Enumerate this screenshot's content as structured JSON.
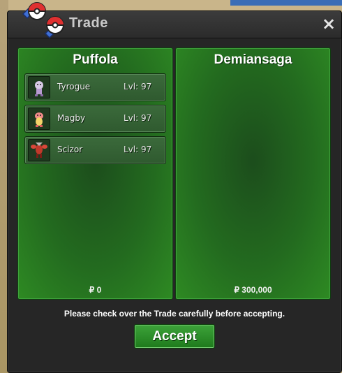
{
  "window": {
    "title": "Trade",
    "close_label": "×"
  },
  "left_panel": {
    "player": "Puffola",
    "pokemon": [
      {
        "name": "Tyrogue",
        "level": "Lvl: 97",
        "icon": "tyrogue-sprite"
      },
      {
        "name": "Magby",
        "level": "Lvl: 97",
        "icon": "magby-sprite"
      },
      {
        "name": "Scizor",
        "level": "Lvl: 97",
        "icon": "scizor-sprite"
      }
    ],
    "money": "₽ 0"
  },
  "right_panel": {
    "player": "Demiansaga",
    "pokemon": [],
    "money": "₽ 300,000"
  },
  "notice": "Please check over the Trade carefully before accepting.",
  "accept_label": "Accept",
  "colors": {
    "panel_green": "#236b1f",
    "window_dark": "#262626",
    "accept_green": "#3da33a"
  }
}
